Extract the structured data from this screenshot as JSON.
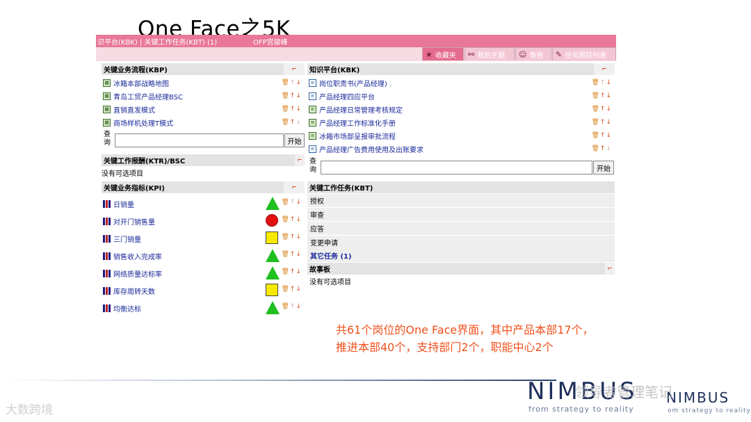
{
  "slide": {
    "title": "One Face之5K",
    "caption_line1": "共61个岗位的One Face界面，其中产品本部17个，",
    "caption_line2": "推进本部40个，支持部门2个，职能中心2个"
  },
  "topbar": {
    "breadcrumb": "识平台(KBK) | 关键工作任务(KBT) (1)",
    "user": "OFP宫骏峰"
  },
  "tabs": [
    {
      "label": "收藏夹",
      "icon": "star-icon"
    },
    {
      "label": "我的主题",
      "icon": "binoculars-icon"
    },
    {
      "label": "角色",
      "icon": "role-icon"
    },
    {
      "label": "任务跟踪列表",
      "icon": "task-icon"
    }
  ],
  "kbp": {
    "header": "关键业务流程(KBP)",
    "items": [
      "冰箱本部战略地图",
      "青岛工贸产品经理BSC",
      "直销直发模式",
      "商场样机处理T模式"
    ],
    "query_label": "查询",
    "query_button": "开始"
  },
  "ktr": {
    "header": "关键工作报酬(KTR)/BSC",
    "empty": "没有可选项目"
  },
  "kpi": {
    "header": "关键业务指标(KPI)",
    "items": [
      {
        "label": "日销量",
        "status": "triangle"
      },
      {
        "label": "对开门销售量",
        "status": "circle"
      },
      {
        "label": "三门销量",
        "status": "square"
      },
      {
        "label": "销售收入完成率",
        "status": "triangle"
      },
      {
        "label": "网络质量达标率",
        "status": "triangle"
      },
      {
        "label": "库存周转天数",
        "status": "square"
      },
      {
        "label": "均衡达标",
        "status": "triangle"
      }
    ]
  },
  "kbk": {
    "header": "知识平台(KBK)",
    "items": [
      "岗位职责书(产品经理) .",
      "产品经理四应平台",
      "产品经理日常管理考核规定",
      "产品经理工作标准化手册",
      "冰箱市场部呈报审批流程",
      "产品经理广告费用使用及出账要求"
    ],
    "query_label": "查询",
    "query_button": "开始"
  },
  "kbt": {
    "header": "关键工作任务(KBT)",
    "items": [
      "授权",
      "审查",
      "应答",
      "变更申请"
    ],
    "other": "其它任务 (1)"
  },
  "story": {
    "header": "故事板",
    "empty": "没有可选项目"
  },
  "branding": {
    "logo": "NIMBUS",
    "logo_repeat": "NIMBUS",
    "tagline": "from strategy to reality",
    "tagline_repeat": "om strategy to reality",
    "watermark": "领导者管理笔记",
    "watermark_left": "大数跨境"
  },
  "colors": {
    "topbar": "#e8779a",
    "caption": "#f0501c",
    "ok": "#1fbf1f",
    "alert": "#e31010",
    "warn": "#f7ea00"
  }
}
